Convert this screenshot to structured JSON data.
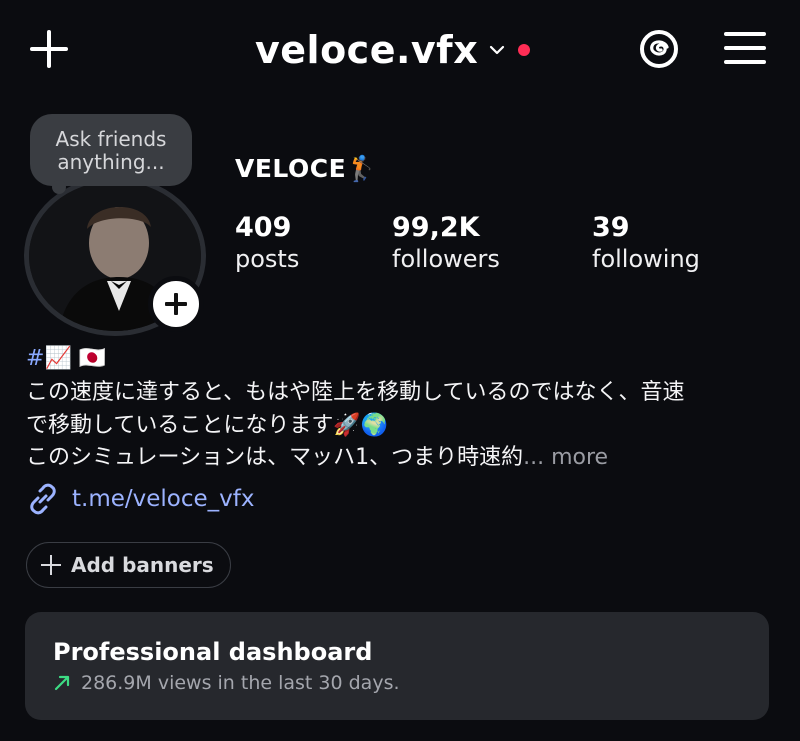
{
  "header": {
    "username": "veloce.vfx",
    "icons": {
      "create": "plus-icon",
      "switch": "chevron-down-icon",
      "notification": "red-dot",
      "threads": "threads-icon",
      "menu": "hamburger-icon"
    }
  },
  "profile": {
    "note": "Ask friends anything...",
    "display_name": "VELOCE🏌️",
    "stats": [
      {
        "value": "409",
        "label": "posts"
      },
      {
        "value": "99,2K",
        "label": "followers"
      },
      {
        "value": "39",
        "label": "following"
      }
    ]
  },
  "bio": {
    "line1_hash": "#",
    "line1_emoji": "📈 🇯🇵",
    "line2": "この速度に達すると、もはや陸上を移動しているのではなく、音速",
    "line3": "で移動していることになります🚀🌍",
    "line4": "このシミュレーションは、マッハ1、つまり時速約",
    "ellipsis": "...",
    "more": "more",
    "link": "t.me/veloce_vfx"
  },
  "banners": {
    "label": "Add banners"
  },
  "dashboard": {
    "title": "Professional dashboard",
    "subtitle": "286.9M views in the last 30 days."
  },
  "colors": {
    "background": "#0b0c10",
    "link": "#9cb3ff",
    "notification_dot": "#ff2d55",
    "trend_green": "#3ddc84",
    "card": "#26282d"
  }
}
